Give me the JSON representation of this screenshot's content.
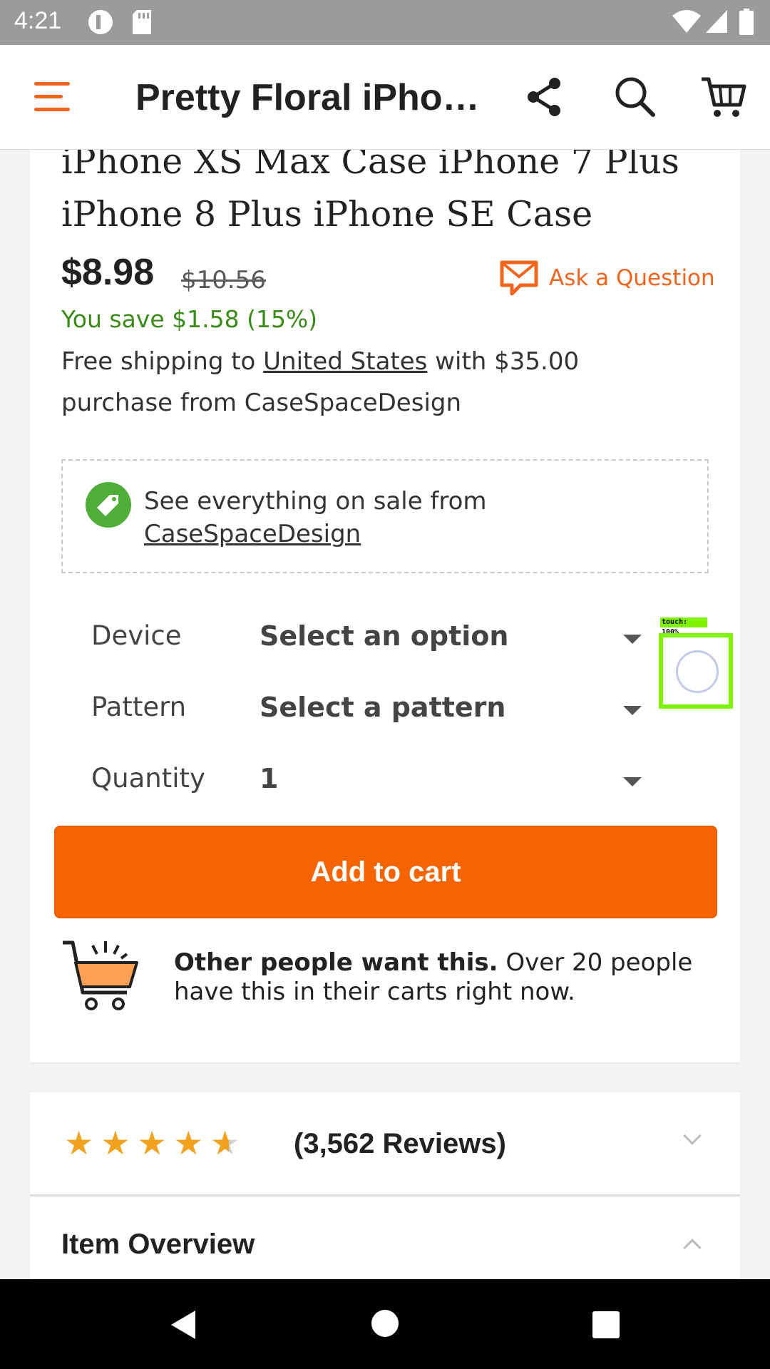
{
  "status_bar": {
    "time": "4:21"
  },
  "app_bar": {
    "title": "Pretty Floral iPho…"
  },
  "product": {
    "title_line1": "iPhone XS Max Case iPhone 7 Plus",
    "title_line2": "iPhone 8 Plus iPhone SE Case",
    "price": "$8.98",
    "original_price": "$10.56",
    "savings": "You save $1.58 (15%)",
    "ask_question": "Ask a Question",
    "shipping_prefix": "Free shipping to ",
    "shipping_country": "United States",
    "shipping_suffix": " with $35.00 purchase from CaseSpaceDesign"
  },
  "sale_box": {
    "text": "See everything on sale from",
    "shop_link": "CaseSpaceDesign"
  },
  "options": [
    {
      "label": "Device",
      "value": "Select an option"
    },
    {
      "label": "Pattern",
      "value": "Select a pattern"
    },
    {
      "label": "Quantity",
      "value": "1"
    }
  ],
  "touch_indicator": {
    "label": "touch: 100%"
  },
  "add_to_cart": "Add to cart",
  "social_proof": {
    "bold": "Other people want this.",
    "rest": " Over 20 people have this in their carts right now."
  },
  "reviews": {
    "count_text": "(3,562 Reviews)",
    "rating": 4.5
  },
  "item_overview": {
    "title": "Item Overview"
  },
  "colors": {
    "accent": "#f1641e",
    "button": "#f56400",
    "savings": "#3b8a1a",
    "star": "#f1a21e"
  }
}
